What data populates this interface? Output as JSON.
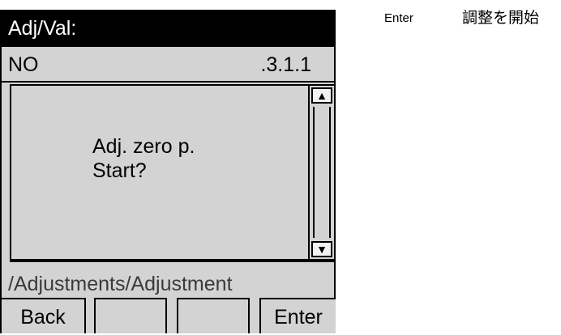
{
  "device": {
    "title": "Adj/Val:",
    "info": {
      "left": "NO",
      "right": ".3.1.1"
    },
    "content": {
      "line1": "Adj. zero p.",
      "line2": "Start?"
    },
    "scroll": {
      "up_icon": "▲",
      "down_icon": "▼"
    },
    "path": "/Adjustments/Adjustment",
    "softkeys": {
      "k1": "Back",
      "k2": "",
      "k3": "",
      "k4": "Enter"
    }
  },
  "side_note": {
    "key": "Enter",
    "desc": "調整を開始"
  }
}
